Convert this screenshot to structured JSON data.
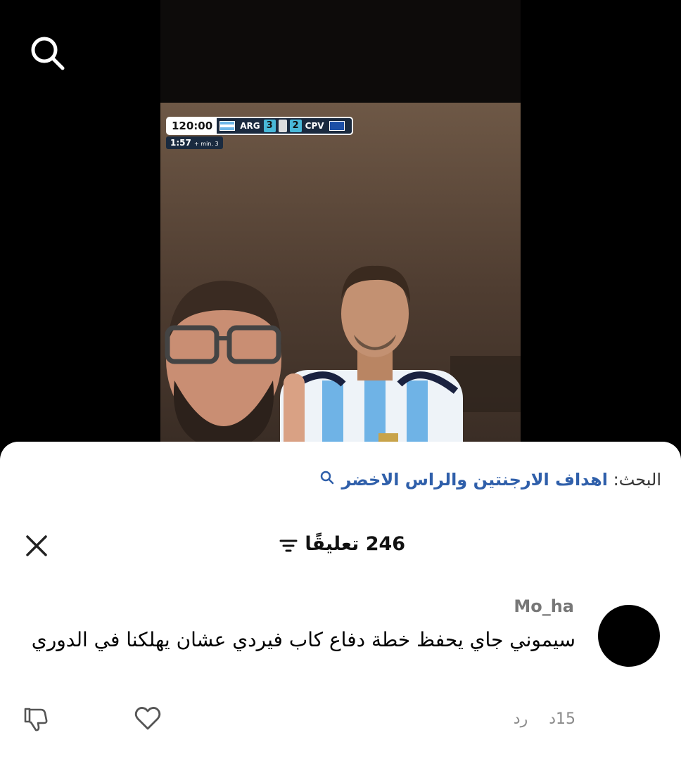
{
  "video": {
    "scorebug": {
      "clock": "120:00",
      "extra_time": "1:57",
      "added_label": "+ min. 3",
      "team_home": "ARG",
      "score_home": "3",
      "score_away": "2",
      "team_away": "CPV"
    }
  },
  "sheet": {
    "search_prefix": "البحث:",
    "search_query": "اهداف الارجنتين والراس الاخضر",
    "comment_count_label": "246 تعليقًا"
  },
  "comments": [
    {
      "username": "Mo_ha",
      "text": "سيموني جاي يحفظ خطة دفاع كاب فيردي عشان يهلكنا في الدوري",
      "time": "15د",
      "reply_label": "رد"
    }
  ],
  "icons": {
    "search": "search-icon",
    "close": "close-icon",
    "filter": "filter-icon",
    "like": "heart-icon",
    "dislike": "thumbs-down-icon"
  }
}
